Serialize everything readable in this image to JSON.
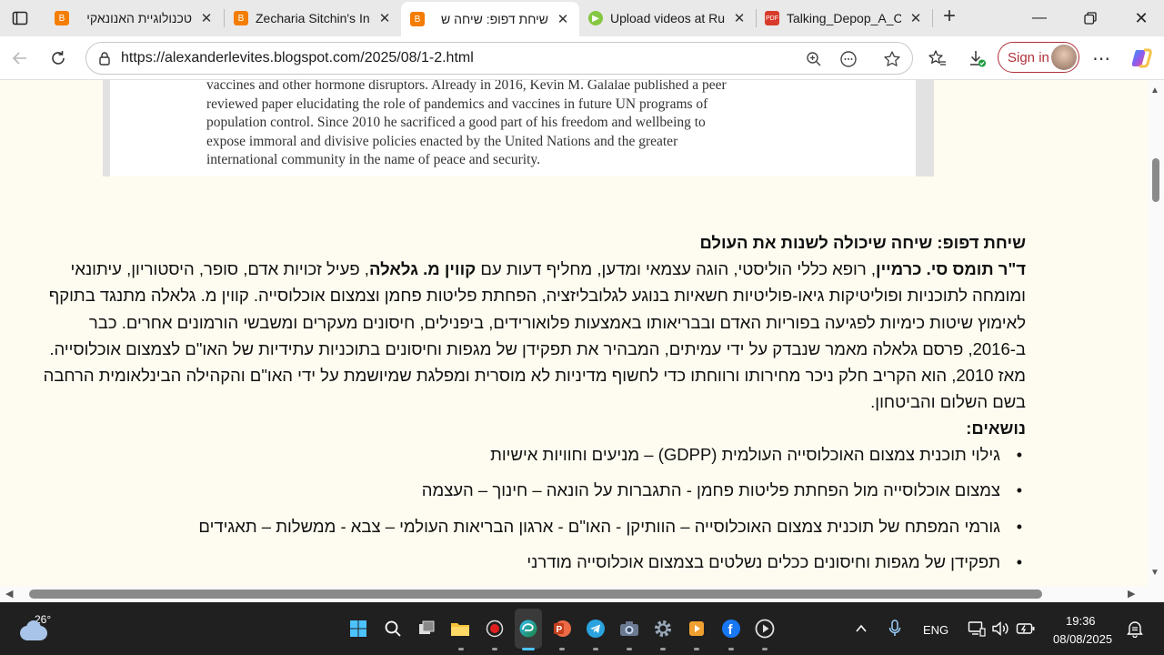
{
  "tabs": [
    {
      "title": "טכנולוגיית האנונאקי",
      "favicon": "blogger-icon",
      "color": "#f57d00"
    },
    {
      "title": "Zecharia Sitchin's In",
      "favicon": "blogger-icon",
      "color": "#f57d00"
    },
    {
      "title": "שיחת דפופ: שיחה ש",
      "favicon": "blogger-icon",
      "color": "#f57d00",
      "active": true
    },
    {
      "title": "Upload videos at Ru",
      "favicon": "rumble-icon",
      "color": "#85c742"
    },
    {
      "title": "Talking_Depop_A_Co",
      "favicon": "pdf-icon",
      "color": "#d83b2b"
    }
  ],
  "address": {
    "url": "https://alexanderlevites.blogspot.com/2025/08/1-2.html"
  },
  "signin_label": "Sign in",
  "scan_lines": [
    "vaccines and other hormone disruptors. Already in 2016, Kevin M. Galalae published a peer",
    "reviewed paper elucidating the role of pandemics and vaccines in future UN programs of",
    "population control. Since 2010 he sacrificed a good part of his freedom and wellbeing to",
    "expose immoral and divisive policies enacted by the United Nations and the greater",
    "international community in the name of peace and security."
  ],
  "article": {
    "heading": "שיחת דפופ: שיחה שיכולה לשנות את העולם",
    "p1_name1": "ד\"ר תומס סי. כרמיין",
    "p1_text1": ", רופא כללי הוליסטי, הוגה עצמאי ומדען, מחליף דעות עם ",
    "p1_name2": "קווין מ. גלאלה",
    "p1_text2": ", פעיל זכויות אדם, סופר, היסטוריון, עיתונאי ומומחה לתוכניות ופוליטיקות גיאו-פוליטיות חשאיות בנוגע לגלובליזציה, הפחתת פליטות פחמן וצמצום אוכלוסייה. קווין מ. גלאלה מתנגד בתוקף לאימוץ שיטות כימיות לפגיעה בפוריות האדם ובבריאותו באמצעות פלואורידים, ביפנילים, חיסונים מעקרים ומשבשי הורמונים אחרים. כבר ב-2016, פרסם גלאלה מאמר שנבדק על ידי עמיתים, המבהיר את תפקידן של מגפות וחיסונים בתוכניות עתידיות של האו\"ם לצמצום אוכלוסייה. מאז 2010, הוא הקריב חלק ניכר מחירותו ורווחתו כדי לחשוף מדיניות לא מוסרית ומפלגת שמיושמת על ידי האו\"ם והקהילה הבינלאומית הרחבה בשם השלום והביטחון.",
    "topics_label": "נושאים:",
    "topics": [
      "גילוי תוכנית צמצום האוכלוסייה העולמית (GDPP) – מניעים וחוויות אישיות",
      "צמצום אוכלוסייה מול הפחתת פליטות פחמן - התגברות על הונאה – חינוך – העצמה",
      "גורמי המפתח של תוכנית צמצום האוכלוסייה – הוותיקן - האו\"ם - ארגון הבריאות העולמי – צבא - ממשלות – תאגידים",
      "תפקידן של מגפות וחיסונים ככלים נשלטים בצמצום אוכלוסייה מודרני"
    ]
  },
  "taskbar": {
    "temperature": "26°",
    "language": "ENG",
    "time": "19:36",
    "date": "08/08/2025"
  }
}
